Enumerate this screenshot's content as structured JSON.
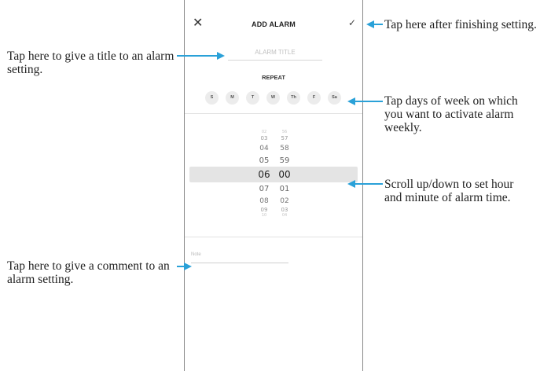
{
  "header": {
    "title": "ADD ALARM",
    "close_icon": "close-icon",
    "confirm_icon": "checkmark-icon"
  },
  "alarm_title": {
    "placeholder": "ALARM TITLE"
  },
  "repeat": {
    "label": "REPEAT",
    "days": [
      "S",
      "M",
      "T",
      "W",
      "Th",
      "F",
      "Sa"
    ]
  },
  "time_picker": {
    "hours": [
      "02",
      "03",
      "04",
      "05",
      "06",
      "07",
      "08",
      "09",
      "10"
    ],
    "minutes": [
      "56",
      "57",
      "58",
      "59",
      "00",
      "01",
      "02",
      "03",
      "04"
    ],
    "selected_hour": "06",
    "selected_minute": "00"
  },
  "note": {
    "placeholder": "Note"
  },
  "annotations": {
    "title_tip": "Tap here to give a title to an alarm setting.",
    "finish_tip": "Tap here after finishing setting.",
    "days_tip": "Tap days of week on which you want to activate alarm weekly.",
    "scroll_tip": "Scroll up/down to set hour and minute of alarm time.",
    "note_tip": "Tap here to give a comment to an alarm setting."
  },
  "colors": {
    "arrow": "#2aa1d8",
    "selection": "#e4e4e4",
    "day_bg": "#ececec"
  }
}
